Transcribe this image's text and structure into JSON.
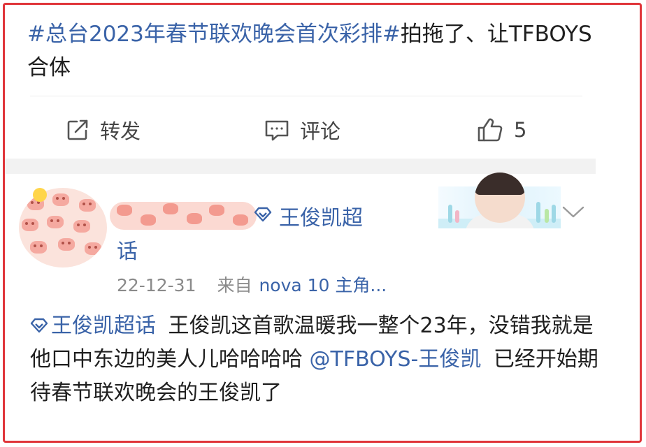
{
  "post": {
    "topic": "#总台2023年春节联欢晚会首次彩排#",
    "text": "拍拖了、让TFBOYS合体"
  },
  "actions": {
    "repost_label": "转发",
    "comment_label": "评论",
    "like_count": "5"
  },
  "comment": {
    "user_supertopic": "王俊凯超话",
    "date": "22-12-31",
    "source_prefix": "来自",
    "source": "nova 10 主角...",
    "topic_link": "王俊凯超话",
    "text_part1": "王俊凯这首歌温暖我一整个23年，没错我就是他口中东边的美人儿哈哈哈哈",
    "mention": "@TFBOYS-王俊凯",
    "text_part2": "已经开始期待春节联欢晚会的王俊凯了"
  },
  "icons": {
    "repost": "share-edit-icon",
    "comment": "comment-icon",
    "like": "thumbs-up-icon",
    "diamond": "diamond-supertopic-icon",
    "menu": "chevron-down-icon"
  },
  "colors": {
    "link": "#3a63a8",
    "border": "#e0353a",
    "text": "#1f1f1f",
    "meta": "#8a8a8a"
  }
}
